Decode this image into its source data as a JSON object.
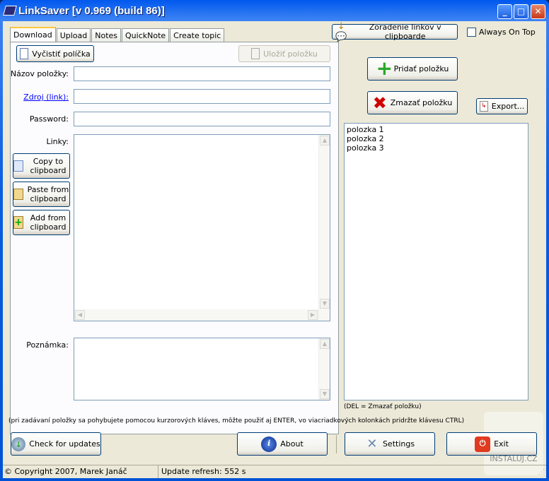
{
  "window": {
    "title": "LinkSaver [v 0.969 (build 86)]"
  },
  "tabs": [
    "Download",
    "Upload",
    "Notes",
    "QuickNote",
    "Create topic"
  ],
  "top": {
    "sort_label": "Zoradenie linkov v clipboarde",
    "always_on_top": "Always On Top",
    "always_on_top_checked": false
  },
  "form": {
    "clear_label": "Vyčistiť políčka",
    "save_label": "Uložiť položku",
    "name_label": "Názov položky:",
    "source_label": "Zdroj (link):",
    "password_label": "Password:",
    "links_label": "Linky:",
    "note_label": "Poznámka:",
    "copy_label": "Copy to clipboard",
    "paste_label": "Paste from clipboard",
    "add_label": "Add from clipboard",
    "name_value": "",
    "source_value": "",
    "password_value": ""
  },
  "right": {
    "add_label": "Pridať položku",
    "delete_label": "Zmazať položku",
    "export_label": "Export...",
    "items": [
      "polozka 1",
      "polozka 2",
      "polozka 3"
    ],
    "hint": "(DEL = Zmazať položku)"
  },
  "hint": "(pri zadávaní položky sa pohybujete pomocou kurzorových kláves, môžte použiť aj ENTER, vo viacriadkových kolonkách pridržte klávesu CTRL)",
  "bottom": {
    "updates": "Check for updates",
    "about": "About",
    "settings": "Settings",
    "exit": "Exit"
  },
  "status": {
    "copyright": "© Copyright 2007, Marek Janáč",
    "refresh": "Update refresh: 552 s"
  },
  "watermark": "INSTALUJ.CZ"
}
